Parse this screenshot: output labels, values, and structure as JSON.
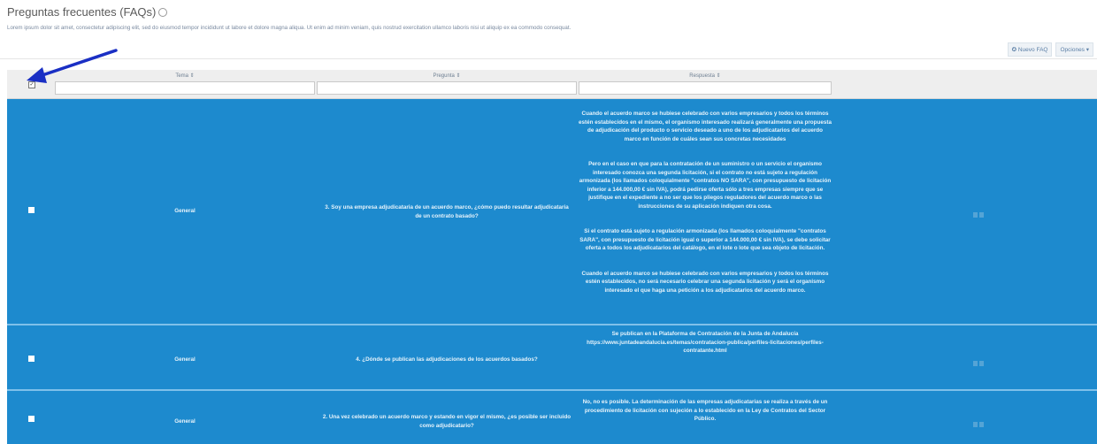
{
  "page": {
    "title": "Preguntas frecuentes (FAQs)",
    "description": "Lorem ipsum dolor sit amet, consectetur adipiscing elit, sed do eiusmod tempor incididunt ut labore et dolore magna aliqua. Ut enim ad minim veniam, quis nostrud exercitation ullamco laboris nisi ut aliquip ex ea commodo consequat."
  },
  "toolbar": {
    "new_label": "✪ Nuevo FAQ",
    "options_label": "Opciones ▾"
  },
  "table": {
    "columns": [
      {
        "label": "Tema ⇕"
      },
      {
        "label": "Pregunta ⇕"
      },
      {
        "label": "Respuesta ⇕"
      }
    ],
    "select_all_checked": true,
    "rows": [
      {
        "tema": "General",
        "pregunta": "3. Soy una empresa adjudicataria de un acuerdo marco, ¿cómo puedo resultar adjudicataria de un contrato basado?",
        "respuesta": [
          "Cuando el acuerdo marco se hubiese celebrado con varios empresarios y todos los términos estén establecidos en el mismo, el organismo interesado realizará generalmente una propuesta de adjudicación del producto o servicio deseado a uno de los adjudicatarios del acuerdo marco en función de cuáles sean sus concretas necesidades",
          "Pero en el caso en que para la contratación de un suministro o un servicio el organismo interesado conozca una segunda licitación, si el contrato no está sujeto a regulación armonizada (los llamados coloquialmente \"contratos NO SARA\", con presupuesto de licitación inferior a 144.000,00 € sin IVA), podrá pedirse oferta sólo a tres empresas siempre que se justifique en el expediente a no ser que los pliegos reguladores del acuerdo marco o las instrucciones de su aplicación indiquen otra cosa.",
          "Si el contrato está sujeto a regulación armonizada (los llamados coloquialmente \"contratos SARA\", con presupuesto de licitación igual o superior a 144.000,00 € sin IVA), se debe solicitar oferta a todos los adjudicatarios del catálogo, en el lote o lote que sea objeto de licitación.",
          "Cuando el acuerdo marco se hubiese celebrado con varios empresarios y todos los términos estén establecidos, no será necesario celebrar una segunda licitación y será el organismo interesado el que haga una petición a los adjudicatarios del acuerdo marco."
        ]
      },
      {
        "tema": "General",
        "pregunta": "4. ¿Dónde se publican las adjudicaciones de los acuerdos basados?",
        "respuesta": [
          "Se publican en la Plataforma de Contratación de la Junta de Andalucía https://www.juntadeandalucia.es/temas/contratacion-publica/perfiles-licitaciones/perfiles-contratante.html"
        ]
      },
      {
        "tema": "General",
        "pregunta": "2. Una vez celebrado un acuerdo marco y estando en vigor el mismo, ¿es posible ser incluido como adjudicatario?",
        "respuesta": [
          "No, no es posible. La determinación de las empresas adjudicatarias se realiza a través de un procedimiento de licitación con sujeción a lo establecido en la Ley de Contratos del Sector Público."
        ]
      }
    ]
  },
  "colors": {
    "row_bg": "#1d8ace",
    "header_bg": "#eeeeee",
    "arrow": "#1a2fc4"
  }
}
